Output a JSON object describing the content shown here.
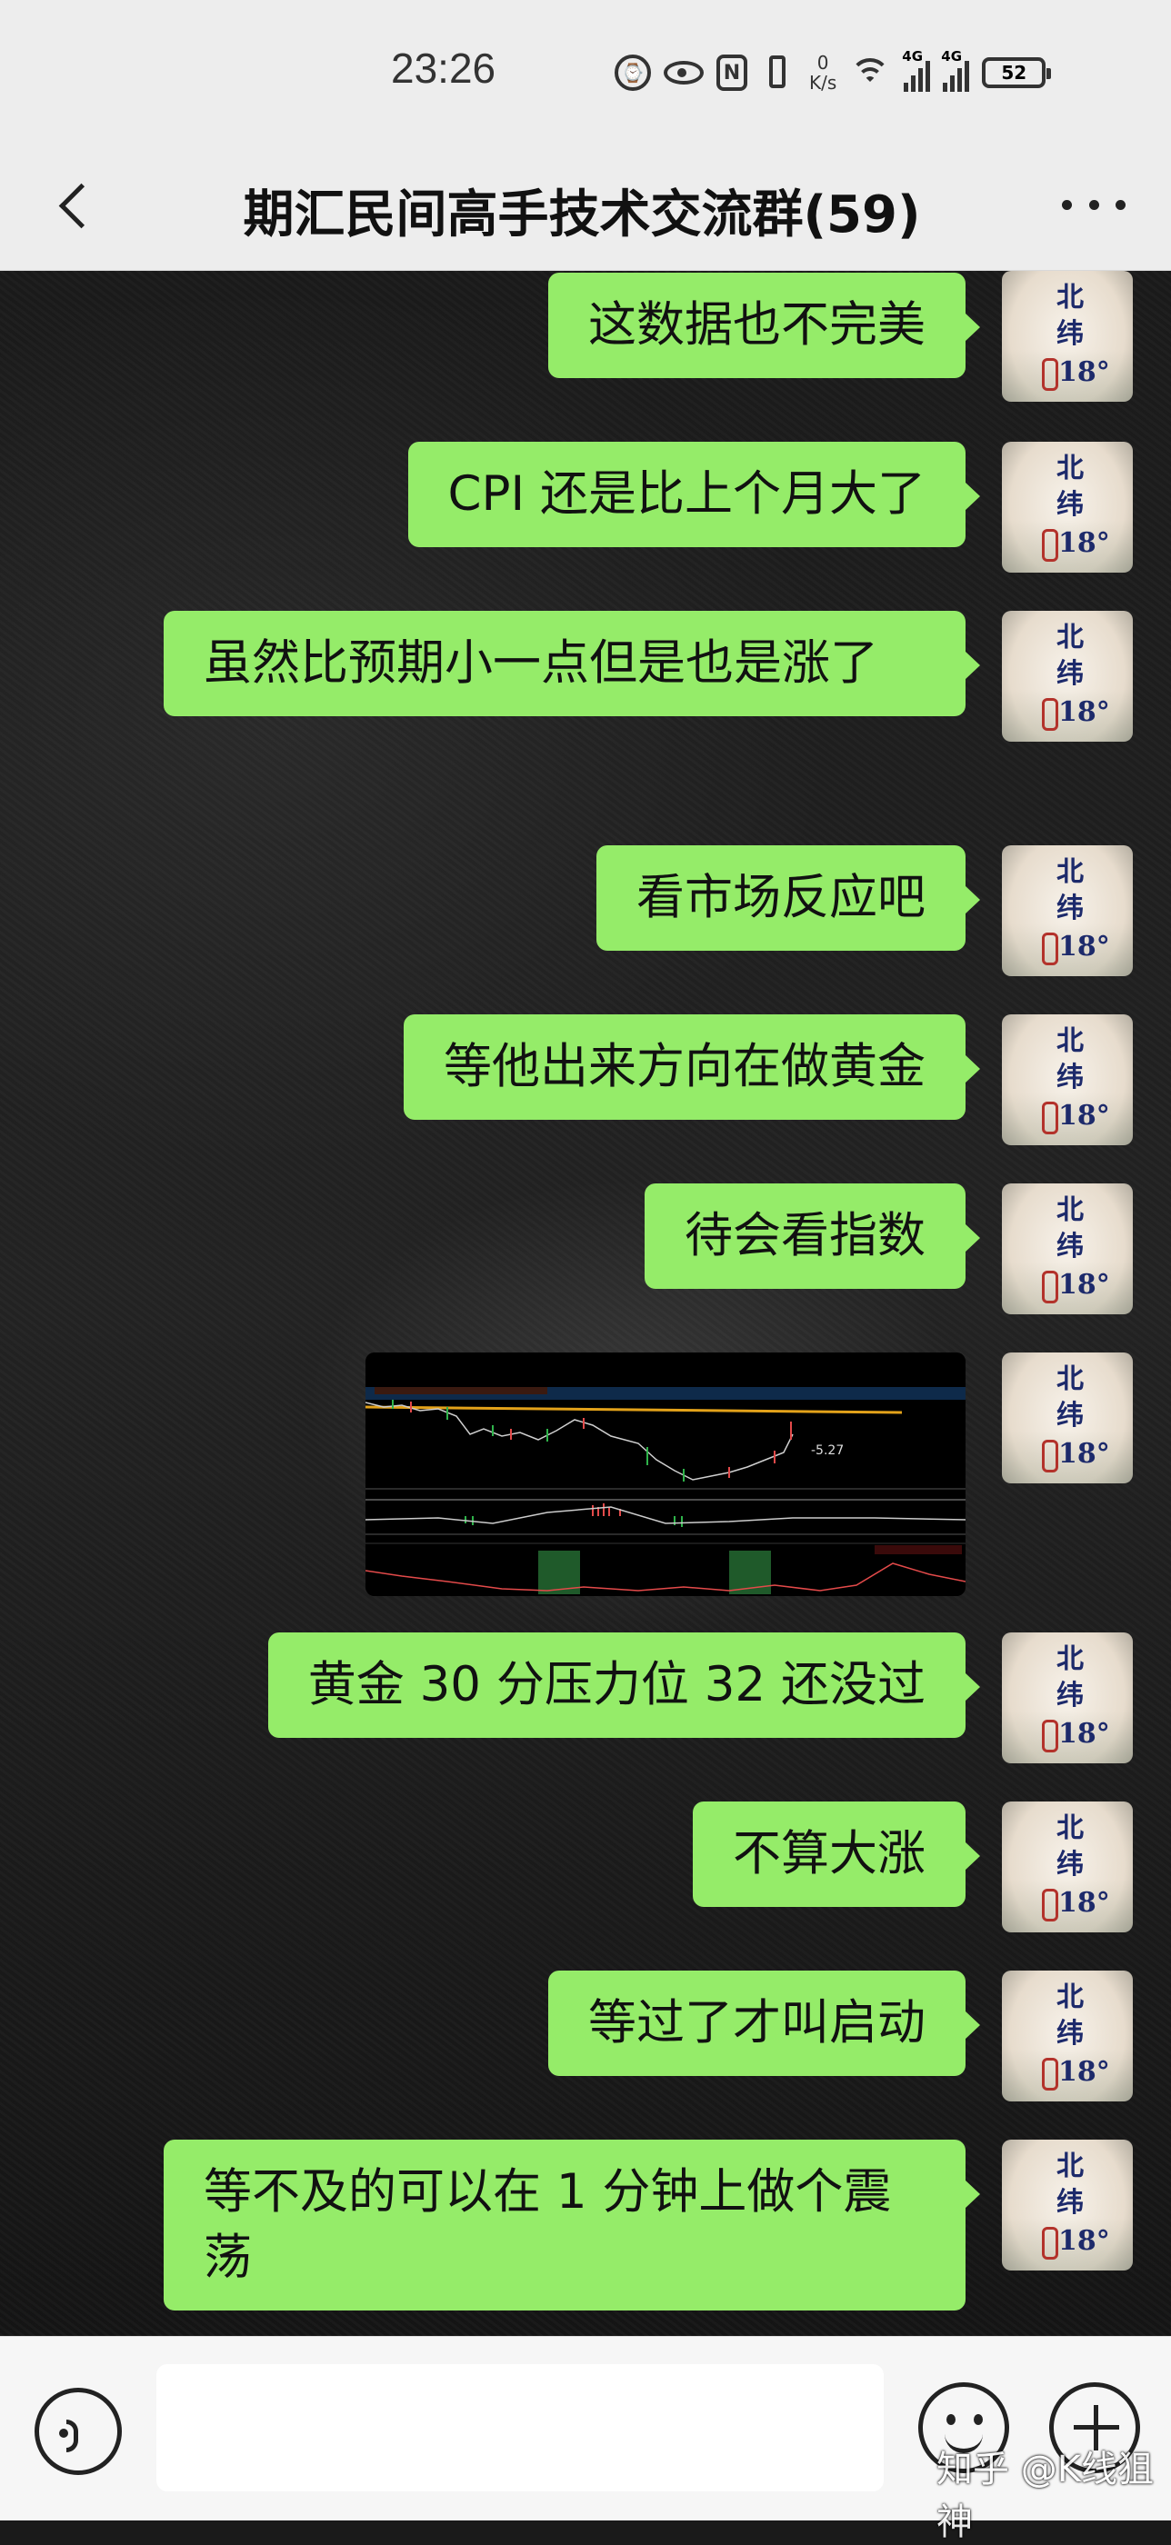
{
  "status_bar": {
    "time": "23:26",
    "net_speed_value": "0",
    "net_speed_unit": "K/s",
    "sim1_label": "4G",
    "sim2_label": "4G",
    "battery": "52",
    "icons": [
      "alarm-icon",
      "eye-icon",
      "nfc-icon",
      "vibrate-icon",
      "wifi-icon",
      "signal-icon",
      "signal-icon",
      "battery-icon"
    ]
  },
  "header": {
    "title": "期汇民间高手技术交流群(59)",
    "back_icon": "chevron-left-icon",
    "more_icon": "more-dots-icon"
  },
  "messages": [
    {
      "type": "text",
      "text": "这数据也不完美"
    },
    {
      "type": "text",
      "text": "CPI 还是比上个月大了"
    },
    {
      "type": "text",
      "text": "虽然比预期小一点但是也是涨了"
    },
    {
      "type": "text",
      "text": "看市场反应吧"
    },
    {
      "type": "text",
      "text": "等他出来方向在做黄金"
    },
    {
      "type": "text",
      "text": "待会看指数"
    },
    {
      "type": "image",
      "alt": "trading-chart-screenshot",
      "label": "-5.27"
    },
    {
      "type": "text",
      "text": "黄金 30 分压力位 32 还没过"
    },
    {
      "type": "text",
      "text": "不算大涨"
    },
    {
      "type": "text",
      "text": "等过了才叫启动"
    },
    {
      "type": "text",
      "text": "等不及的可以在 1 分钟上做个震荡"
    }
  ],
  "avatar": {
    "line1": "北",
    "line2": "纬",
    "line3": "18",
    "degree": "°"
  },
  "input_bar": {
    "placeholder": "",
    "watermark": "知乎 @K线狙神"
  },
  "colors": {
    "bubble": "#95ec69",
    "header_bg": "#ededed",
    "chat_bg": "#1b1b1b"
  }
}
